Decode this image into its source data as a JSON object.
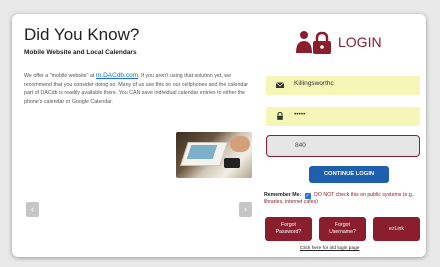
{
  "info": {
    "title": "Did You Know?",
    "subtitle": "Mobile Website and Local Calendars",
    "para_before_link": "We offer a \"mobile website\" at ",
    "link": "m.DACdb.com",
    "para_after_link": ". If you aren't using that solution yet, we recommend that you consider doing so. Many of us use this on our cellphones and the calendar part of DACdb is readily available there. You CAN save individual calendar entries to either the phone's calendar or Google Calendar."
  },
  "nav": {
    "prev": "‹",
    "next": "›"
  },
  "login": {
    "title": "LOGIN",
    "username": "Killingsworthc",
    "password": "•••••",
    "code": "840",
    "continue_label": "CONTINUE LOGIN",
    "remember_label": "Remember Me:",
    "remember_checked": true,
    "remember_note": "DO NOT check this on public systems (e.g., libraries, internet cafes)",
    "forgot_password": "Forgot Password?",
    "forgot_username": "Forgot Username?",
    "ezlink": "ezLink",
    "old_login": "Click here for old login page"
  },
  "colors": {
    "brand": "#8b1e2d",
    "button_blue": "#1f5fb0",
    "field_yellow": "#f6f6b6"
  }
}
